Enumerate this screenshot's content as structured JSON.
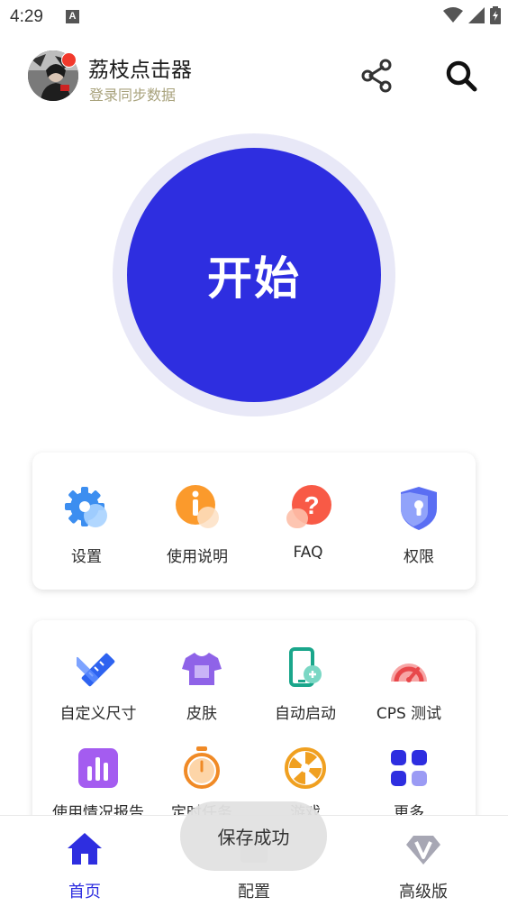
{
  "status_bar": {
    "time": "4:29",
    "notification_letter": "A"
  },
  "header": {
    "title": "荔枝点击器",
    "subtitle": "登录同步数据",
    "avatar": "user-avatar-icon"
  },
  "start": {
    "label": "开始"
  },
  "quick_menu": [
    {
      "label": "设置",
      "icon": "gear-icon"
    },
    {
      "label": "使用说明",
      "icon": "info-icon"
    },
    {
      "label": "FAQ",
      "icon": "question-icon"
    },
    {
      "label": "权限",
      "icon": "shield-lock-icon"
    }
  ],
  "tools": [
    {
      "label": "自定义尺寸",
      "icon": "ruler-pencil-icon"
    },
    {
      "label": "皮肤",
      "icon": "shirt-icon"
    },
    {
      "label": "自动启动",
      "icon": "phone-link-icon"
    },
    {
      "label": "CPS 测试",
      "icon": "gauge-icon"
    },
    {
      "label": "使用情况报告",
      "icon": "bar-chart-icon"
    },
    {
      "label": "定时任务",
      "icon": "stopwatch-icon"
    },
    {
      "label": "游戏",
      "icon": "wheel-icon"
    },
    {
      "label": "更多",
      "icon": "grid-icon"
    }
  ],
  "bottom_nav": [
    {
      "label": "首页",
      "icon": "home-icon",
      "active": true
    },
    {
      "label": "配置",
      "icon": "config-icon",
      "active": false
    },
    {
      "label": "高级版",
      "icon": "diamond-v-icon",
      "active": false
    }
  ],
  "toast": {
    "text": "保存成功"
  },
  "colors": {
    "primary": "#2e2ee0",
    "ring": "#e8e8f7",
    "subtitle": "#a8a27c",
    "badge": "#f2392c"
  }
}
